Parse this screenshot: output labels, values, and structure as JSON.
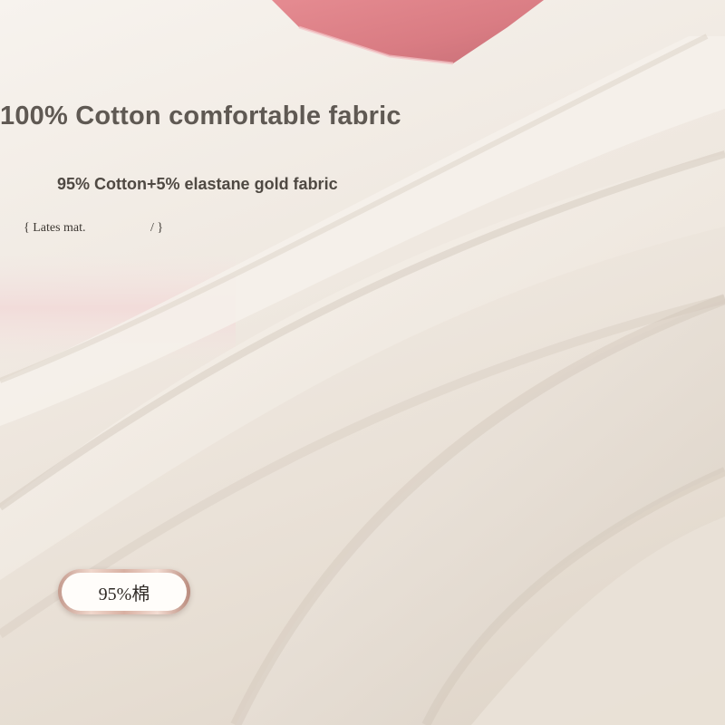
{
  "headline": "100% Cotton comfortable fabric",
  "subline": "95% Cotton+5% elastane gold fabric",
  "tagline": {
    "open": "{ Lates mat.",
    "close": "/ }"
  },
  "badge": {
    "label": "95%棉"
  },
  "palette": {
    "fabric": "#efe8e0",
    "waistband": "#e2838a",
    "text": "#5f5953",
    "badge_rim": "#d8b0a2"
  }
}
